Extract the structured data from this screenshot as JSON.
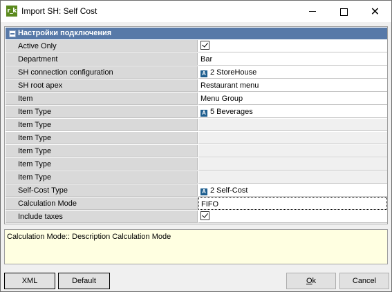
{
  "window": {
    "icon_text": "r_k",
    "title": "Import SH: Self Cost"
  },
  "group": {
    "title": "Настройки подключения"
  },
  "rows": [
    {
      "label": "Active Only",
      "value": "",
      "kind": "checkbox",
      "checked": true
    },
    {
      "label": "Department",
      "value": "Bar",
      "kind": "text"
    },
    {
      "label": "SH connection configuration",
      "value": "2 StoreHouse",
      "kind": "ref"
    },
    {
      "label": "SH root apex",
      "value": "Restaurant menu",
      "kind": "text"
    },
    {
      "label": "Item",
      "value": "Menu Group",
      "kind": "text"
    },
    {
      "label": "Item Type",
      "value": "5 Beverages",
      "kind": "ref"
    },
    {
      "label": "Item Type",
      "value": "",
      "kind": "empty"
    },
    {
      "label": "Item Type",
      "value": "",
      "kind": "empty"
    },
    {
      "label": "Item Type",
      "value": "",
      "kind": "empty"
    },
    {
      "label": "Item Type",
      "value": "",
      "kind": "empty"
    },
    {
      "label": "Item Type",
      "value": "",
      "kind": "empty"
    },
    {
      "label": "Self-Cost Type",
      "value": "2 Self-Cost",
      "kind": "ref"
    },
    {
      "label": "Calculation Mode",
      "value": "FIFO",
      "kind": "text",
      "active": true
    },
    {
      "label": "Include taxes",
      "value": "",
      "kind": "checkbox",
      "checked": true
    }
  ],
  "description": {
    "text": "Calculation Mode:: Description Calculation Mode"
  },
  "buttons": {
    "xml": "XML",
    "default": "Default",
    "ok_prefix": "O",
    "ok_rest": "k",
    "cancel": "Cancel"
  },
  "colors": {
    "group_header": "#5779a8",
    "description_bg": "#ffffe1",
    "ref_icon": "#1f5f8f"
  }
}
